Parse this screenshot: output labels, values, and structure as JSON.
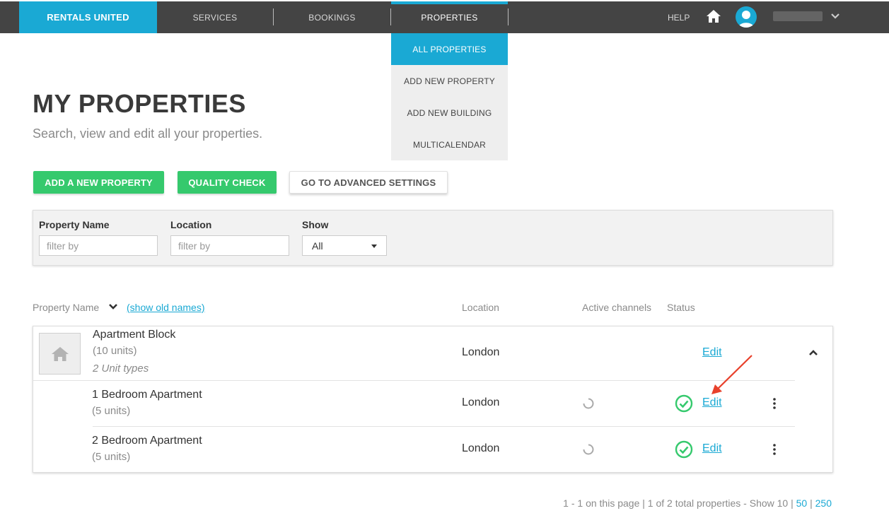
{
  "nav": {
    "logo": "RENTALS UNITED",
    "items": [
      "SERVICES",
      "BOOKINGS",
      "PROPERTIES"
    ],
    "help": "HELP",
    "accent": "#1aa9d4"
  },
  "dropdown": {
    "items": [
      "ALL PROPERTIES",
      "ADD NEW PROPERTY",
      "ADD NEW BUILDING",
      "MULTICALENDAR"
    ]
  },
  "page": {
    "title": "MY PROPERTIES",
    "subtitle": "Search, view and edit all your properties."
  },
  "actions": {
    "add_property": "ADD A NEW PROPERTY",
    "quality_check": "QUALITY CHECK",
    "advanced_settings": "GO TO ADVANCED SETTINGS",
    "green": "#35c96d"
  },
  "filters": {
    "property_name_label": "Property Name",
    "property_name_placeholder": "filter by",
    "location_label": "Location",
    "location_placeholder": "filter by",
    "show_label": "Show",
    "show_value": "All"
  },
  "table": {
    "headers": {
      "property_name": "Property Name",
      "show_old_names": "(show old names)",
      "location": "Location",
      "active_channels": "Active channels",
      "status": "Status"
    },
    "building": {
      "name": "Apartment Block",
      "units": "(10 units)",
      "unit_types": "2 Unit types",
      "location": "London",
      "edit": "Edit"
    },
    "units": [
      {
        "name": "1 Bedroom Apartment",
        "units": "(5 units)",
        "location": "London",
        "edit": "Edit"
      },
      {
        "name": "2 Bedroom Apartment",
        "units": "(5 units)",
        "location": "London",
        "edit": "Edit"
      }
    ]
  },
  "pagination": {
    "summary": "1 - 1 on this page | 1 of 2 total properties - Show 10 | ",
    "option_50": "50",
    "sep": " | ",
    "option_250": "250"
  }
}
